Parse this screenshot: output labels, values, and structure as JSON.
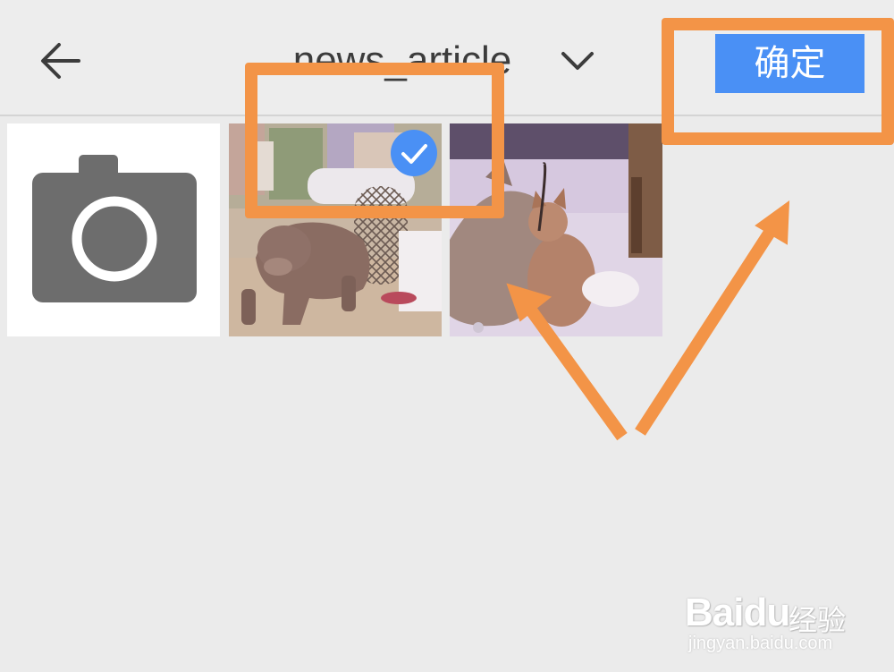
{
  "header": {
    "back_icon": "arrow-left-icon",
    "album_title": "news_article",
    "dropdown_icon": "chevron-down-icon",
    "confirm_label": "确定"
  },
  "grid": {
    "tiles": [
      {
        "kind": "camera",
        "icon": "camera-icon"
      },
      {
        "kind": "photo",
        "subject": "dog",
        "selected": true
      },
      {
        "kind": "photo",
        "subject": "cat",
        "selected": false
      }
    ]
  },
  "watermark": {
    "logo": "Baidu",
    "brand_cn": "经验",
    "url": "jingyan.baidu.com"
  },
  "colors": {
    "accent": "#4a90f5",
    "annotation": "#f39447",
    "camera_icon": "#6d6d6d"
  }
}
